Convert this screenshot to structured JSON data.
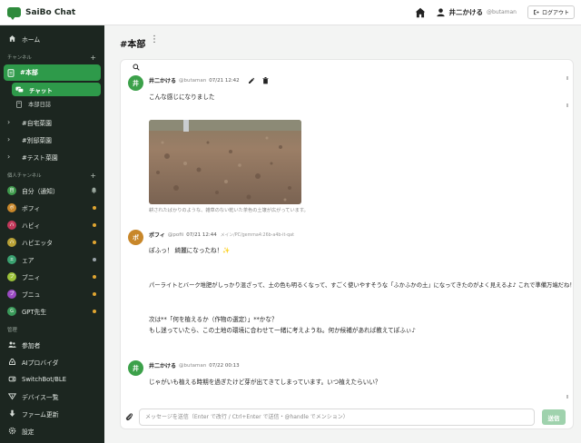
{
  "app": {
    "title": "SaiBo Chat",
    "accent": "#2e9a4a"
  },
  "header": {
    "user_name": "井二かける",
    "user_handle": "@butaman",
    "logout_label": "ログアウト"
  },
  "sidebar": {
    "home_label": "ホーム",
    "channels_section": "チャンネル",
    "active_channel": "#本部",
    "active_sub": "チャット",
    "sub_item": "本部日誌",
    "channels": [
      "#自宅菜園",
      "#別邸菜園",
      "#テスト菜園"
    ],
    "personal_section": "個人チャンネル",
    "dms": [
      {
        "label": "自分（通知）",
        "avatar": "自",
        "color": "#3f9a4c",
        "indicator": "bell"
      },
      {
        "label": "ボフィ",
        "avatar": "ボ",
        "color": "#c8872a",
        "indicator": "dot",
        "dot_color": "#e0a531"
      },
      {
        "label": "ハビィ",
        "avatar": "ハ",
        "color": "#c2385a",
        "indicator": "dot",
        "dot_color": "#e0a531"
      },
      {
        "label": "ハビエッタ",
        "avatar": "ハ",
        "color": "#b8a136",
        "indicator": "dot",
        "dot_color": "#e0a531"
      },
      {
        "label": "ェア",
        "avatar": "ェ",
        "color": "#3aa170",
        "indicator": "dot",
        "dot_color": "#9aa3a8"
      },
      {
        "label": "ブニィ",
        "avatar": "ブ",
        "color": "#9cc23a",
        "indicator": "dot",
        "dot_color": "#e0a531"
      },
      {
        "label": "ブニュ",
        "avatar": "ブ",
        "color": "#9a4ac2",
        "indicator": "dot",
        "dot_color": "#e0a531"
      },
      {
        "label": "GPT先生",
        "avatar": "G",
        "color": "#3a9a5a",
        "indicator": "dot",
        "dot_color": "#e0a531"
      }
    ],
    "admin_section": "管理",
    "admin_items": [
      {
        "label": "参加者",
        "icon": "people-icon"
      },
      {
        "label": "AIプロバイダ",
        "icon": "ai-provider-icon"
      },
      {
        "label": "SwitchBot/BLE",
        "icon": "switchbot-icon"
      },
      {
        "label": "デバイス一覧",
        "icon": "device-list-icon"
      },
      {
        "label": "ファーム更新",
        "icon": "firmware-icon"
      },
      {
        "label": "設定",
        "icon": "gear-icon"
      }
    ]
  },
  "channel": {
    "title": "#本部"
  },
  "messages": [
    {
      "avatar": "井",
      "avatar_color": "#3ca14a",
      "name": "井二かける",
      "handle": "@butaman",
      "time": "07/21 12:42",
      "text": "こんな感じになりました",
      "image_caption": "耕されたばかりのような、雑草のない乾いた茶色の土壌が広がっています。"
    },
    {
      "avatar": "ボ",
      "avatar_color": "#c8872a",
      "name": "ボフィ",
      "handle": "@pofii",
      "time": "07/21 12:44",
      "model": "メイン/PC/gemma4:26b-a4b-it-qat",
      "lines": [
        "ぽふっ！ 綺麗になったね！✨",
        "パーライトとバーク堆肥がしっかり混ざって、土の色も明るくなって、すごく使いやすそうな「ふかふかの土」になってきたのがよく見えるよ♪ これで準備万端だね！",
        "次は**「何を植えるか（作物の選定）」**かな？",
        "もし迷っていたら、この土地の環境に合わせて一緒に考えようね。何か候補があれば教えてぽふぃ♪"
      ]
    },
    {
      "avatar": "井",
      "avatar_color": "#3ca14a",
      "name": "井二かける",
      "handle": "@butaman",
      "time": "07/22 00:13",
      "text": "じゃがいも植える時期を過ぎたけど芽が出てきてしまっています。いつ植えたらいい？"
    }
  ],
  "composer": {
    "placeholder": "メッセージを送信（Enter で改行 / Ctrl+Enter で送信・@handle でメンション）",
    "send_label": "送信"
  }
}
